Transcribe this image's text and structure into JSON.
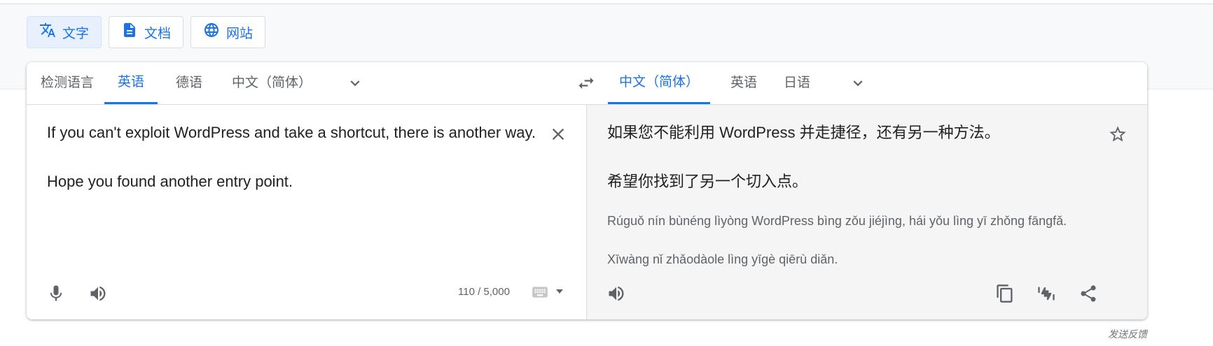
{
  "mode_tabs": [
    {
      "label": "文字",
      "icon": "translate-icon",
      "active": true
    },
    {
      "label": "文档",
      "icon": "document-icon",
      "active": false
    },
    {
      "label": "网站",
      "icon": "globe-icon",
      "active": false
    }
  ],
  "source_langs": [
    "检测语言",
    "英语",
    "德语",
    "中文（简体）"
  ],
  "source_active": "英语",
  "target_langs": [
    "中文（简体）",
    "英语",
    "日语"
  ],
  "target_active": "中文（简体）",
  "source": {
    "paragraphs": [
      "If you can't exploit WordPress and take a shortcut, there is another way.",
      "Hope you found another entry point."
    ],
    "char_count": "110 / 5,000"
  },
  "target": {
    "paragraphs": [
      "如果您不能利用 WordPress 并走捷径，还有另一种方法。",
      "希望你找到了另一个切入点。"
    ],
    "romanization": [
      "Rúguǒ nín bùnéng lìyòng WordPress bìng zǒu jiéjìng, hái yǒu lìng yī zhǒng fāngfǎ.",
      "Xīwàng nǐ zhǎodàole lìng yīgè qiērù diǎn."
    ]
  },
  "feedback_label": "发送反馈",
  "colors": {
    "accent": "#1a73e8",
    "muted": "#5f6368",
    "target_bg": "#f5f5f5"
  }
}
